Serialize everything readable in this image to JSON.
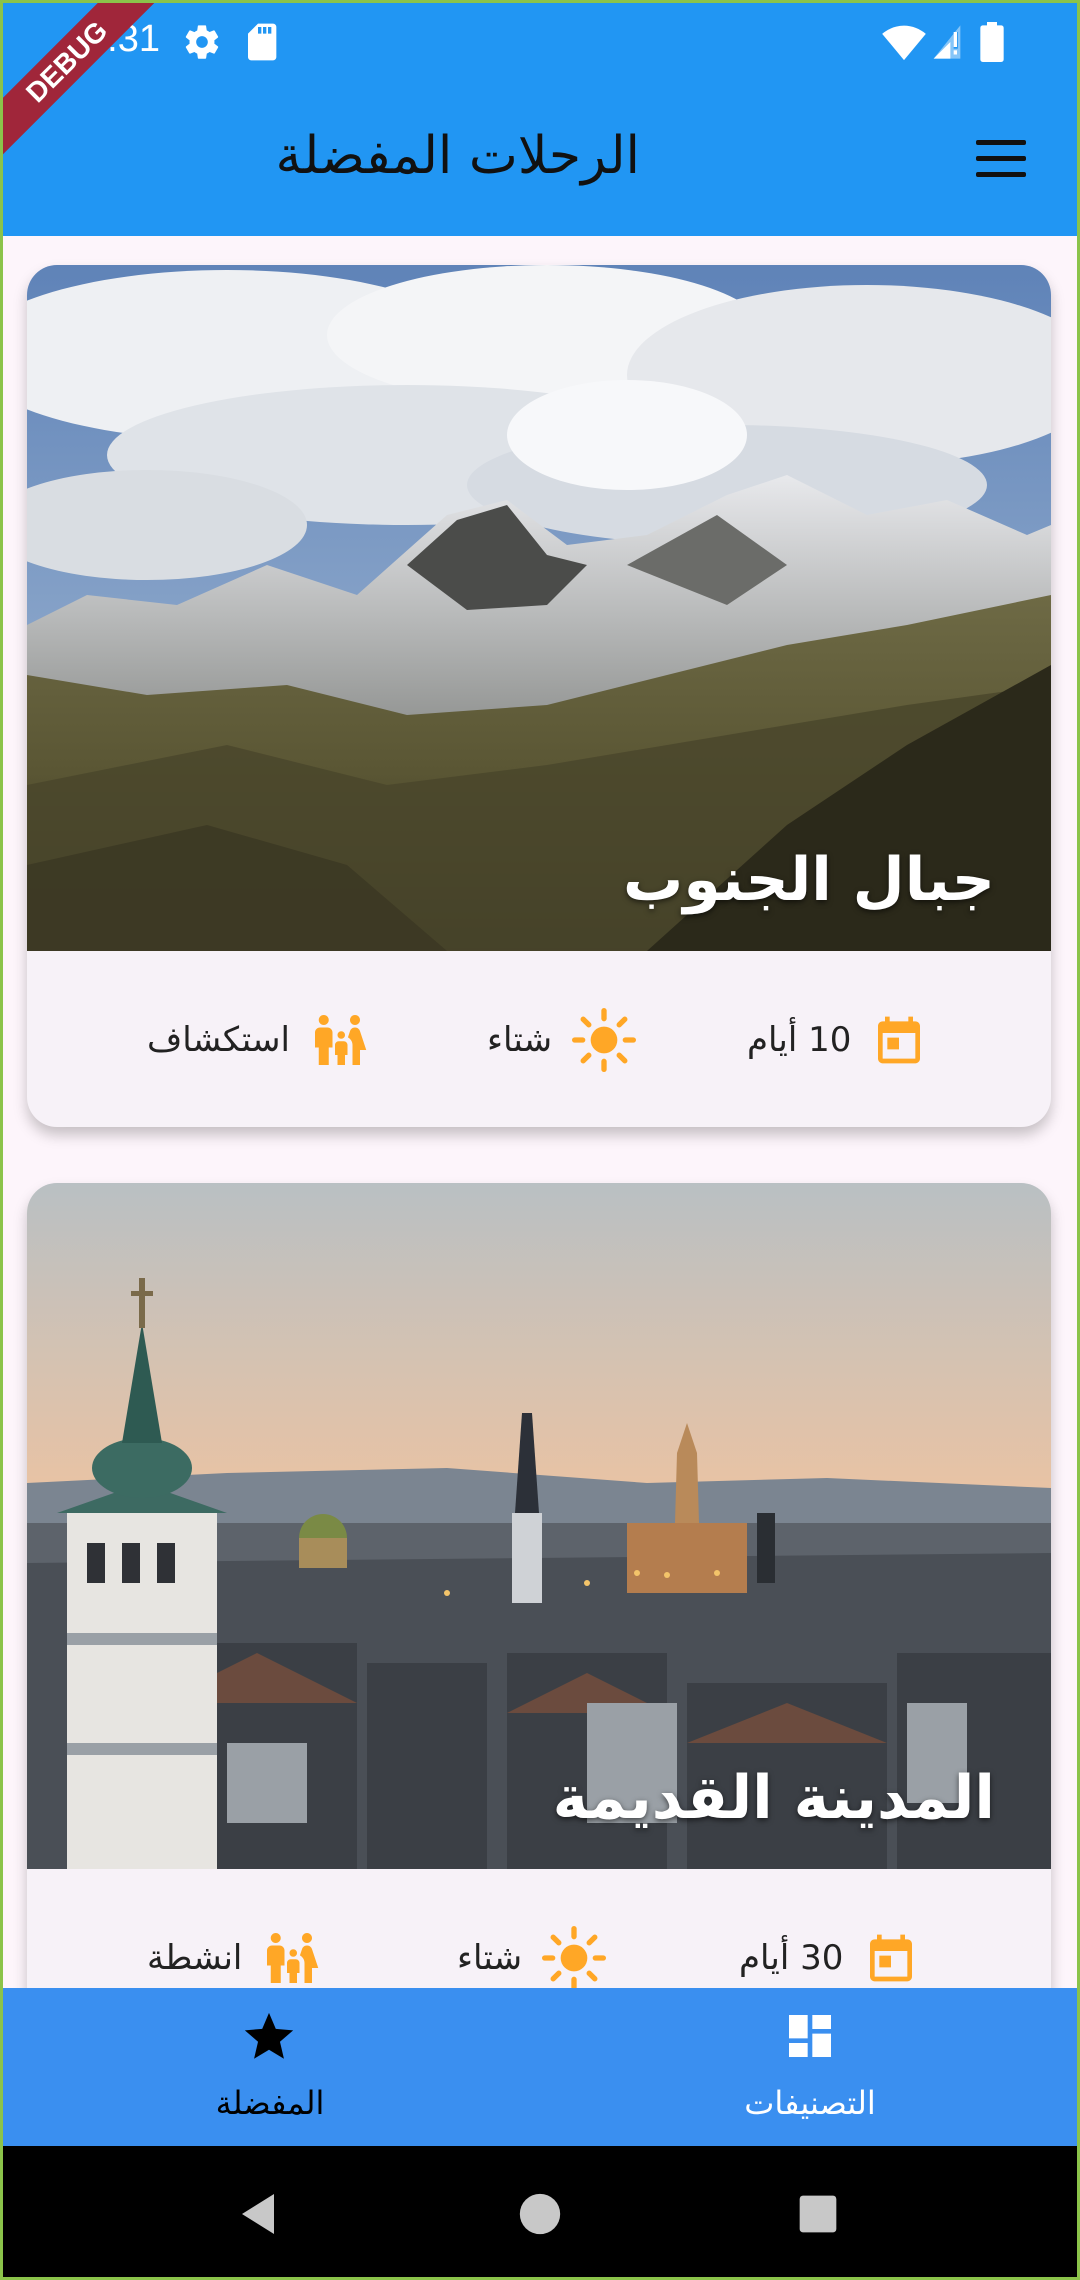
{
  "status_bar": {
    "time": "1:31",
    "debug_banner": "DEBUG",
    "icons": [
      "settings-icon",
      "sd-card-icon",
      "wifi-icon",
      "signal-icon",
      "battery-icon"
    ]
  },
  "app_bar": {
    "title": "الرحلات المفضلة",
    "menu_icon": "menu-icon"
  },
  "trips": [
    {
      "title": "جبال الجنوب",
      "image": "mountains-photo",
      "duration": "10 أيام",
      "season": "شتاء",
      "type": "استكشاف"
    },
    {
      "title": "المدينة القديمة",
      "image": "old-city-photo",
      "duration": "30 أيام",
      "season": "شتاء",
      "type": "انشطة"
    }
  ],
  "bottom_nav": {
    "favorites_label": "المفضلة",
    "categories_label": "التصنيفات",
    "selected": "favorites"
  },
  "colors": {
    "primary": "#2196f3",
    "bottom_nav": "#3a8ff0",
    "accent_icon": "#ffa726",
    "card_bg": "#f7f2f8"
  }
}
